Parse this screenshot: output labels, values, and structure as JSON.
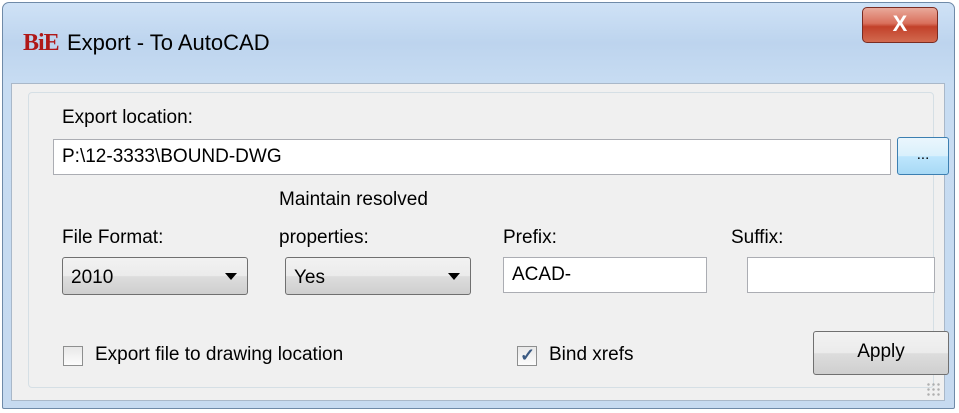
{
  "window": {
    "app_icon_text": "BiE",
    "title": "Export - To AutoCAD",
    "close_glyph": "X",
    "close_icon": "close-icon"
  },
  "export_location": {
    "label": "Export location:",
    "value": "P:\\12-3333\\BOUND-DWG",
    "browse_label": "..."
  },
  "file_format": {
    "label": "File Format:",
    "selected": "2010"
  },
  "maintain": {
    "label_line1": "Maintain resolved",
    "label_line2": "properties:",
    "selected": "Yes"
  },
  "prefix": {
    "label": "Prefix:",
    "value": "ACAD-"
  },
  "suffix": {
    "label": "Suffix:",
    "value": ""
  },
  "export_to_drawing": {
    "label": "Export file to drawing location",
    "checked": false
  },
  "bind_xrefs": {
    "label": "Bind xrefs",
    "checked": true,
    "check_glyph": "✓"
  },
  "apply_label": "Apply",
  "colors": {
    "close_button": "#c2412a",
    "title_bar": "#c6daf0",
    "client_background": "#f0f0f0",
    "browse_button_highlight": "#a7d9f5"
  }
}
